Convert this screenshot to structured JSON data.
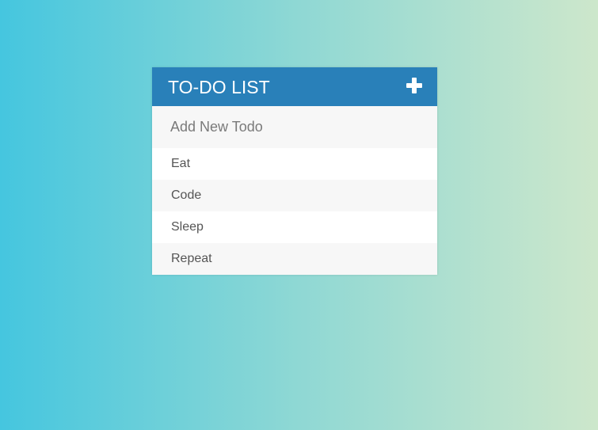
{
  "todo": {
    "title": "TO-DO LIST",
    "add_icon": "plus-icon",
    "input_placeholder": "Add New Todo",
    "input_value": "",
    "items": [
      {
        "label": "Eat"
      },
      {
        "label": "Code"
      },
      {
        "label": "Sleep"
      },
      {
        "label": "Repeat"
      }
    ]
  },
  "colors": {
    "header_bg": "#2980b9",
    "gradient_start": "#45c6df",
    "gradient_end": "#cde7cb"
  }
}
